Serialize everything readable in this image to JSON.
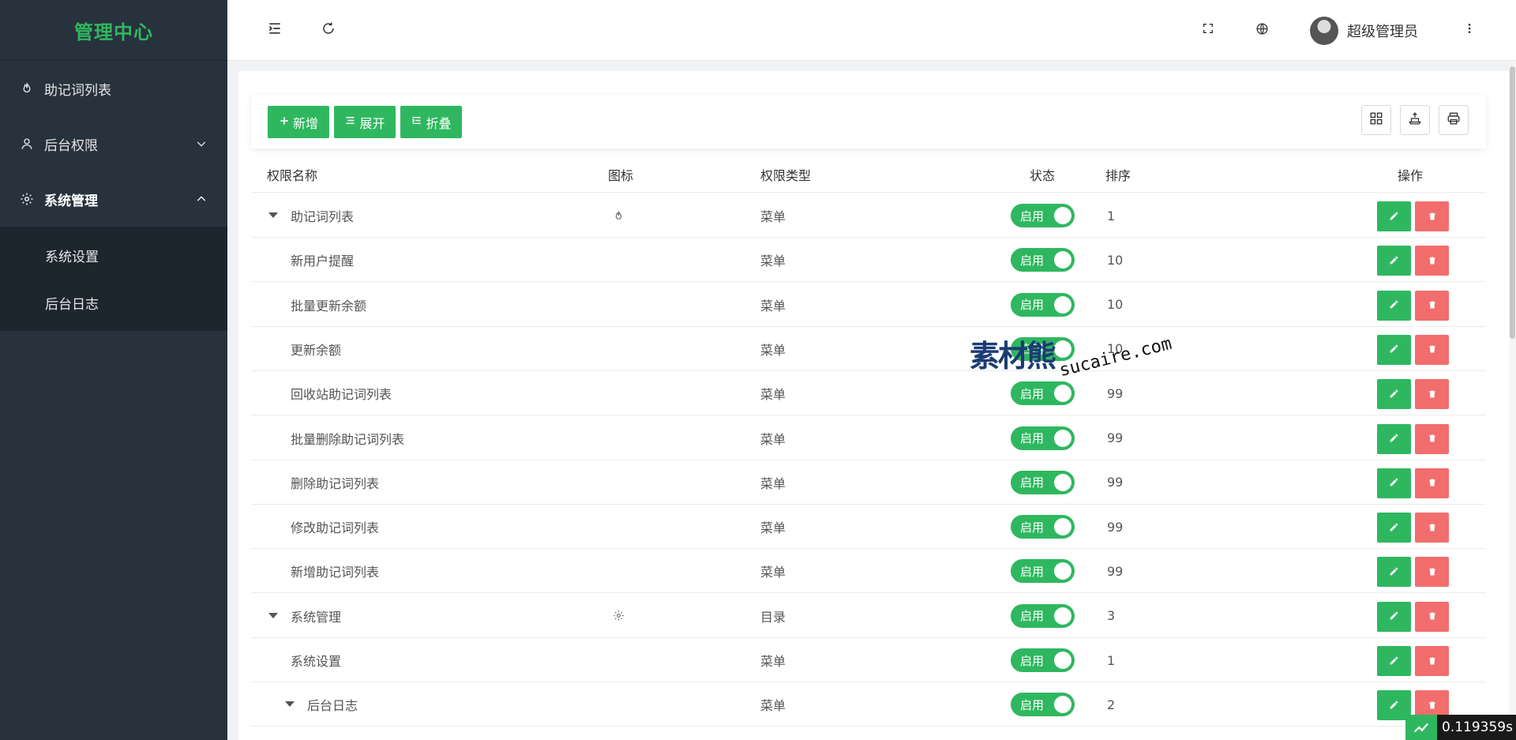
{
  "sidebar": {
    "brand": "管理中心",
    "items": [
      {
        "label": "助记词列表",
        "icon": "fire-icon"
      },
      {
        "label": "后台权限",
        "icon": "user-icon"
      },
      {
        "label": "系统管理",
        "icon": "gear-icon"
      }
    ],
    "submenu": [
      {
        "label": "系统设置"
      },
      {
        "label": "后台日志"
      }
    ]
  },
  "header": {
    "user_name": "超级管理员"
  },
  "toolbar": {
    "add_label": "新增",
    "expand_label": "展开",
    "collapse_label": "折叠"
  },
  "table": {
    "columns": [
      "权限名称",
      "图标",
      "权限类型",
      "状态",
      "排序",
      "操作"
    ],
    "rows": [
      {
        "name": "助记词列表",
        "icon": "fire-icon",
        "type": "菜单",
        "status": "启用",
        "order": "1",
        "level": 0,
        "expandable": true
      },
      {
        "name": "新用户提醒",
        "icon": "",
        "type": "菜单",
        "status": "启用",
        "order": "10",
        "level": 1,
        "expandable": false
      },
      {
        "name": "批量更新余额",
        "icon": "",
        "type": "菜单",
        "status": "启用",
        "order": "10",
        "level": 1,
        "expandable": false
      },
      {
        "name": "更新余额",
        "icon": "",
        "type": "菜单",
        "status": "启用",
        "order": "10",
        "level": 1,
        "expandable": false
      },
      {
        "name": "回收站助记词列表",
        "icon": "",
        "type": "菜单",
        "status": "启用",
        "order": "99",
        "level": 1,
        "expandable": false
      },
      {
        "name": "批量删除助记词列表",
        "icon": "",
        "type": "菜单",
        "status": "启用",
        "order": "99",
        "level": 1,
        "expandable": false
      },
      {
        "name": "删除助记词列表",
        "icon": "",
        "type": "菜单",
        "status": "启用",
        "order": "99",
        "level": 1,
        "expandable": false
      },
      {
        "name": "修改助记词列表",
        "icon": "",
        "type": "菜单",
        "status": "启用",
        "order": "99",
        "level": 1,
        "expandable": false
      },
      {
        "name": "新增助记词列表",
        "icon": "",
        "type": "菜单",
        "status": "启用",
        "order": "99",
        "level": 1,
        "expandable": false
      },
      {
        "name": "系统管理",
        "icon": "gear-icon",
        "type": "目录",
        "status": "启用",
        "order": "3",
        "level": 0,
        "expandable": true
      },
      {
        "name": "系统设置",
        "icon": "",
        "type": "菜单",
        "status": "启用",
        "order": "1",
        "level": 1,
        "expandable": false
      },
      {
        "name": "后台日志",
        "icon": "",
        "type": "菜单",
        "status": "启用",
        "order": "2",
        "level": 2,
        "expandable": true
      }
    ]
  },
  "watermark": {
    "logo": "素材熊",
    "url": "sucaire.com"
  },
  "timer": {
    "value": "0.119359s"
  },
  "colors": {
    "primary": "#2fb760",
    "danger": "#f26d6d",
    "sidebar_bg": "#28323d"
  }
}
